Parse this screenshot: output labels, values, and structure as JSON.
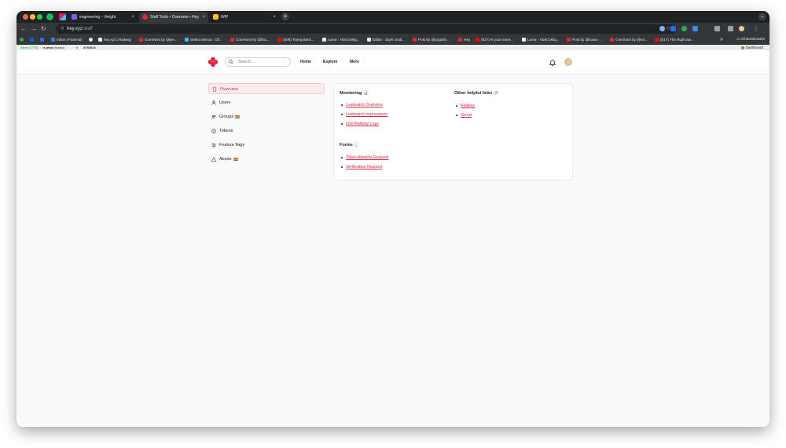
{
  "browser": {
    "tabs": [
      {
        "title": "engineering – Height",
        "active": false
      },
      {
        "title": "Staff Tools • Overview • Hey",
        "active": true
      },
      {
        "title": "WIP",
        "active": false
      }
    ],
    "new_tab": "+",
    "tab_search": "⌄",
    "tab_close": "×",
    "url_host": "hey.xyz",
    "url_path": "/staff",
    "bookmarks": [
      "Inbox | Fastmail",
      "hey.xyz | Railway",
      "Comment by @jes...",
      "Select Menus - Of...",
      "Comment by @bra...",
      "(609) Trying Bent...",
      "Luma - Host Delig...",
      "Editor - Style Guid...",
      "Post by @yoginth...",
      "Hey",
      "(527) Is your mem...",
      "Luma - Host Delig...",
      "Post by @luxas -...",
      "Comment by @mr...",
      "(517) The Right wa..."
    ],
    "bookmarks_more": "»",
    "all_bookmarks": "All Bookmarks"
  },
  "devbar": {
    "latency": "43ms (7779)",
    "env": "prod",
    "env_note": "(mainnet)",
    "hash_symbol": "#",
    "commit": "4754914",
    "dashboard": "Dashboard"
  },
  "header": {
    "search_placeholder": "Search...",
    "nav": [
      "Home",
      "Explore",
      "More"
    ]
  },
  "sidebar": {
    "items": [
      {
        "label": "Overview",
        "icon": "document-icon",
        "active": true
      },
      {
        "label": "Users",
        "icon": "user-icon"
      },
      {
        "label": "Groups",
        "icon": "users-icon",
        "badge": "flag"
      },
      {
        "label": "Tokens",
        "icon": "coin-icon"
      },
      {
        "label": "Feature flags",
        "icon": "sliders-icon"
      },
      {
        "label": "Abuse",
        "icon": "warning-icon",
        "badge": "flag"
      }
    ]
  },
  "main": {
    "monitoring": {
      "title": "Monitoring",
      "emoji": "📊",
      "links": [
        "Leafwatch Overview",
        "Leafwatch Impressions",
        "Live Railway Logs"
      ]
    },
    "forms": {
      "title": "Forms",
      "emoji": "🧾",
      "links": [
        "Token Allowlist Request",
        "Verification Request"
      ]
    },
    "other_links": {
      "title": "Other helpful links",
      "emoji": "🔗",
      "links": [
        "Railway",
        "Vercel"
      ]
    }
  },
  "colors": {
    "accent": "#e0263d",
    "accent_bg": "#fdecee",
    "browser_dark": "#35363a",
    "page_bg": "#fafafa"
  }
}
